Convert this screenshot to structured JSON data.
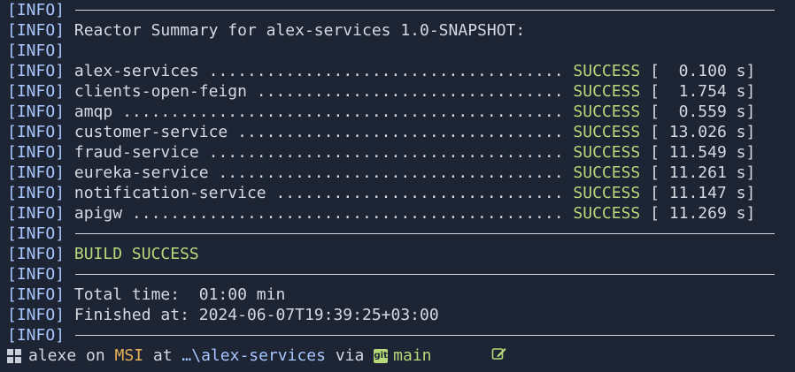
{
  "info_tag": "[INFO]",
  "summary_header": "Reactor Summary for alex-services 1.0-SNAPSHOT:",
  "modules": [
    {
      "name": "alex-services",
      "dots": " ..................................... ",
      "status": "SUCCESS",
      "time": "[  0.100 s]"
    },
    {
      "name": "clients-open-feign",
      "dots": " ................................ ",
      "status": "SUCCESS",
      "time": "[  1.754 s]"
    },
    {
      "name": "amqp",
      "dots": " .............................................. ",
      "status": "SUCCESS",
      "time": "[  0.559 s]"
    },
    {
      "name": "customer-service",
      "dots": " .................................. ",
      "status": "SUCCESS",
      "time": "[ 13.026 s]"
    },
    {
      "name": "fraud-service",
      "dots": " ..................................... ",
      "status": "SUCCESS",
      "time": "[ 11.549 s]"
    },
    {
      "name": "eureka-service",
      "dots": " .................................... ",
      "status": "SUCCESS",
      "time": "[ 11.261 s]"
    },
    {
      "name": "notification-service",
      "dots": " .............................. ",
      "status": "SUCCESS",
      "time": "[ 11.147 s]"
    },
    {
      "name": "apigw",
      "dots": " ............................................. ",
      "status": "SUCCESS",
      "time": "[ 11.269 s]"
    }
  ],
  "build_result": "BUILD SUCCESS",
  "total_time": "Total time:  01:00 min",
  "finished_at": "Finished at: 2024-06-07T19:39:25+03:00",
  "prompt": {
    "user": "alexe",
    "on": " on ",
    "host": "MSI",
    "at": " at ",
    "path": "…\\alex-services",
    "via": " via ",
    "git_icon": "git",
    "branch": "main",
    "edit_icon": "edit-icon"
  },
  "colors": {
    "background": "#1d2433",
    "info": "#a9c6ff",
    "success": "#b6d97a",
    "host": "#e6b25a",
    "text": "#d4d9e2"
  }
}
